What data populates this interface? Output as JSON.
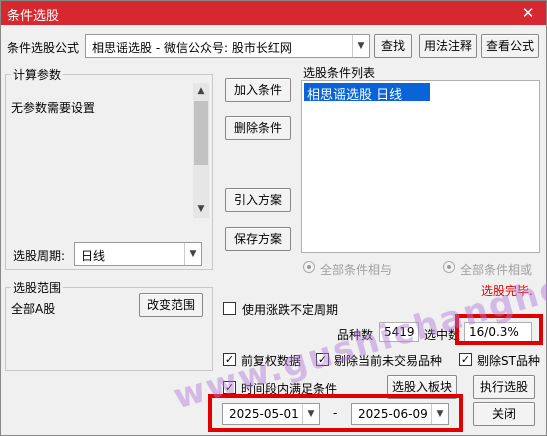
{
  "window": {
    "title": "条件选股",
    "close_glyph": "✕"
  },
  "formula": {
    "label": "条件选股公式",
    "selected": "相思谣选股  -  微信公众号: 股市长红网",
    "find_button": "查找",
    "usage_button": "用法注释",
    "view_button": "查看公式"
  },
  "params": {
    "group_label": "计算参数",
    "no_params_text": "无参数需要设置",
    "period_label": "选股周期:",
    "period_value": "日线"
  },
  "actions": {
    "add": "加入条件",
    "delete": "删除条件",
    "import": "引入方案",
    "save": "保存方案"
  },
  "conditions": {
    "list_label": "选股条件列表",
    "items": [
      "相思谣选股  日线"
    ],
    "radio_and": "全部条件相与",
    "radio_or": "全部条件相或"
  },
  "status": {
    "text": "选股完毕.",
    "color": "#e00000"
  },
  "scope": {
    "group_label": "选股范围",
    "value": "全部A股",
    "change_button": "改变范围"
  },
  "options": {
    "irregular_period_label": "使用涨跌不定周期",
    "count_label": "品种数",
    "count_value": "5419",
    "selected_label": "选中数",
    "selected_value": "16/0.3%",
    "fq_label": "前复权数据",
    "exclude_untraded_label": "剔除当前未交易品种",
    "exclude_st_label": "剔除ST品种",
    "time_range_label": "时间段内满足条件",
    "check_glyph": "✓",
    "to_block_button": "选股入板块",
    "run_button": "执行选股",
    "start_date": "2025-05-01",
    "dash": "-",
    "end_date": "2025-06-09",
    "close_button": "关闭"
  },
  "watermark": {
    "text": "www.gushichanghong.com",
    "color": "#b07ad8"
  }
}
